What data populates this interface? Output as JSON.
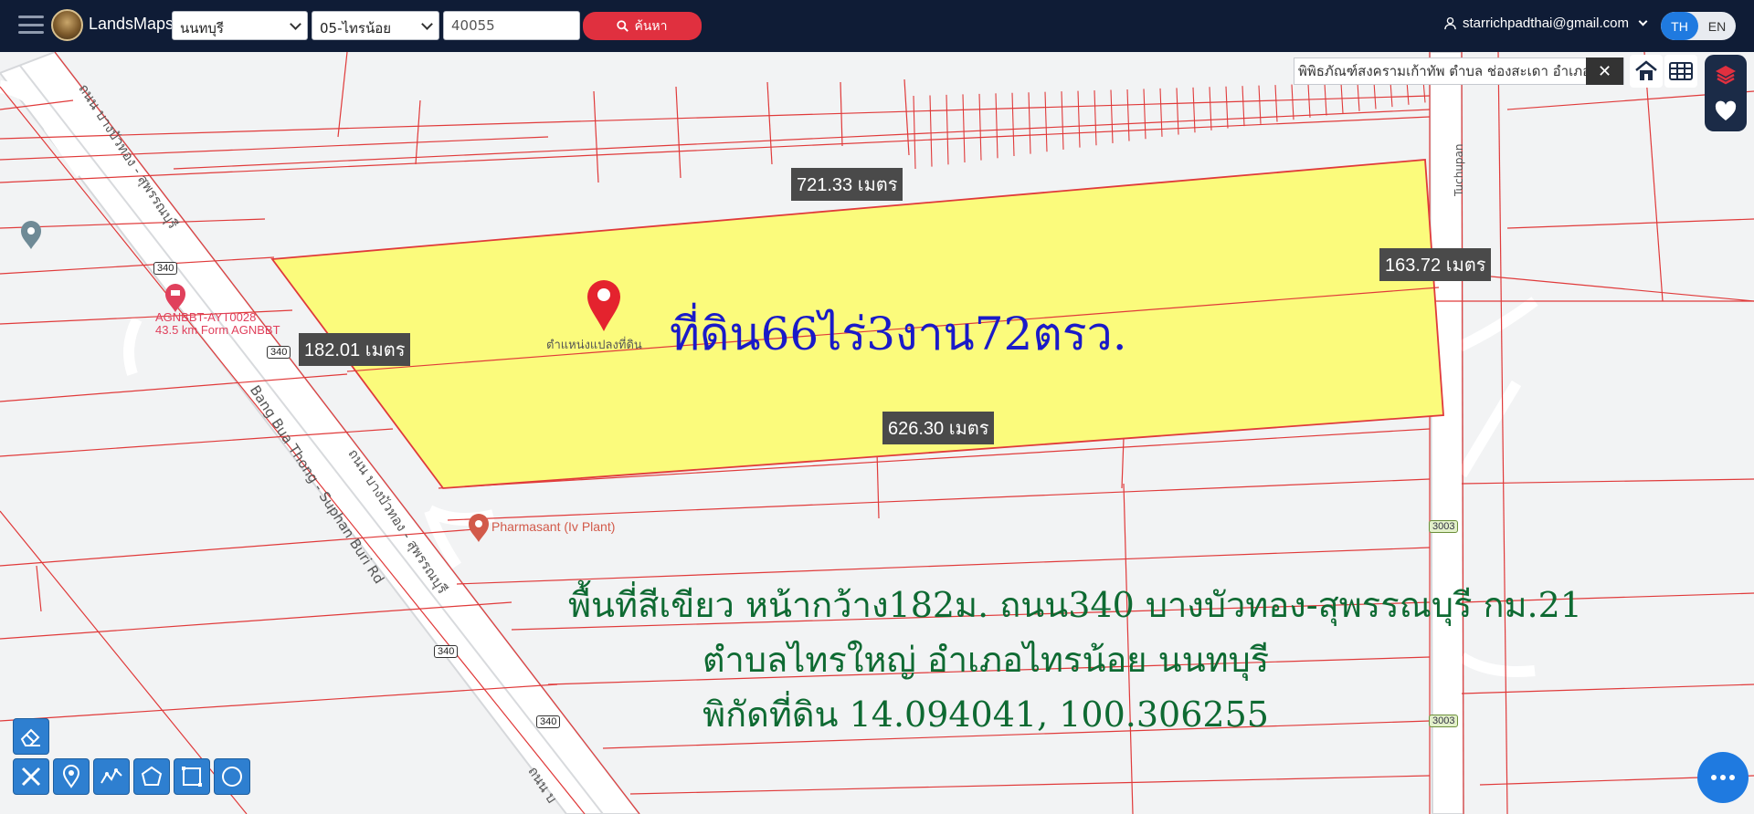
{
  "header": {
    "brand": "LandsMaps",
    "province": "นนทบุรี",
    "district": "05-ไทรน้อย",
    "parcel_number": "40055",
    "search_label": "ค้นหา",
    "user_email": "starrichpadthai@gmail.com",
    "lang_th": "TH",
    "lang_en": "EN"
  },
  "result": {
    "text": "พิพิธภัณฑ์สงครามเก้าทัพ ตำบล ช่องสะเดา อำเภอ",
    "close": "✕"
  },
  "map": {
    "measurements": [
      "721.33 เมตร",
      "163.72 เมตร",
      "182.01 เมตร",
      "626.30 เมตร"
    ],
    "roads": {
      "road_th_1": "ถนน บางบัวทอง - สุพรรณบุรี",
      "road_th_2": "ถนน บางบัวทอง - สุพรรณบุรี",
      "road_th_3": "ถนน บ",
      "road_en": "Bang Bua Thong - Suphan Buri Rd",
      "tuchupan": "Tuchupan"
    },
    "shields": [
      "340",
      "340",
      "340",
      "340",
      "3003",
      "3003"
    ],
    "poi_hotel": "AGNBBT-AYT0028",
    "poi_hotel_sub": "43.5 km Form AGNBBT",
    "poi_plant": "Pharmasant (Iv Plant)",
    "marker_label": "ตำแหน่งแปลงที่ดิน",
    "title": "ที่ดิน66ไร่3งาน72ตรว.",
    "desc_line1": "พื้นที่สีเขียว หน้ากว้าง182ม. ถนน340 บางบัวทอง-สุพรรณบุรี กม.21",
    "desc_line2": "ตำบลไทรใหญ่ อำเภอไทรน้อย นนทบุรี",
    "desc_line3": "พิกัดที่ดิน 14.094041, 100.306255"
  },
  "colors": {
    "header_bg": "#0f1c36",
    "parcel_fill": "#fbfb7c",
    "boundary": "#e03a3a",
    "search_btn": "#e0303f",
    "accent": "#1f7ae0",
    "title_text": "#1a1ac8",
    "desc_text": "#0e6a32"
  },
  "icons": {
    "menu": "hamburger-icon",
    "search": "magnifier-icon",
    "user": "user-icon",
    "home": "home-icon",
    "grid": "grid-icon",
    "layers": "layers-icon",
    "favorite": "heart-icon",
    "eraser": "eraser-icon",
    "measure": "ruler-pencil-icon",
    "pin": "pin-icon",
    "line": "polyline-icon",
    "polygon": "polygon-icon",
    "rectangle": "rectangle-icon",
    "circle": "circle-icon",
    "more": "more-icon"
  }
}
